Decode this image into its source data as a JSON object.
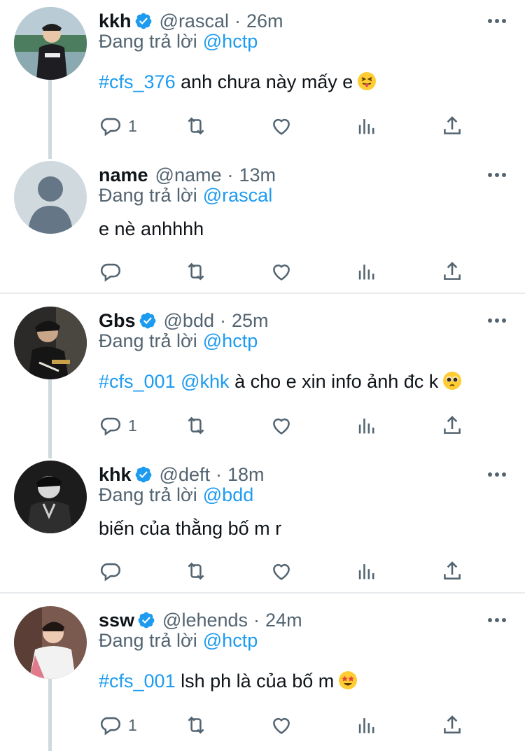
{
  "reply_prefix": "Đang trả lời",
  "tweets": [
    {
      "name": "kkh",
      "verified": true,
      "handle": "@rascal",
      "time": "26m",
      "reply_to": "@hctp",
      "tags": [
        "#cfs_376"
      ],
      "text": "anh chưa này mấy e",
      "emoji": "squinting-tongue",
      "reply_count": "1",
      "avatar": "photo"
    },
    {
      "name": "name",
      "verified": false,
      "handle": "@name",
      "time": "13m",
      "reply_to": "@rascal",
      "tags": [],
      "text": "e nè anhhhh",
      "emoji": "",
      "reply_count": "",
      "avatar": "default"
    },
    {
      "name": "Gbs",
      "verified": true,
      "handle": "@bdd",
      "time": "25m",
      "reply_to": "@hctp",
      "tags": [
        "#cfs_001",
        "@khk"
      ],
      "text": "à cho e xin info ảnh đc k",
      "emoji": "pleading",
      "reply_count": "1",
      "avatar": "photo"
    },
    {
      "name": "khk",
      "verified": true,
      "handle": "@deft",
      "time": "18m",
      "reply_to": "@bdd",
      "tags": [],
      "text": "biến của thằng bố m r",
      "emoji": "",
      "reply_count": "",
      "avatar": "photo"
    },
    {
      "name": "ssw",
      "verified": true,
      "handle": "@lehends",
      "time": "24m",
      "reply_to": "@hctp",
      "tags": [
        "#cfs_001"
      ],
      "text": "lsh ph là của bố m",
      "emoji": "star-struck",
      "reply_count": "1",
      "avatar": "photo"
    }
  ],
  "icons": {
    "reply": "reply-icon",
    "retweet": "retweet-icon",
    "like": "heart-icon",
    "views": "analytics-icon",
    "share": "share-icon",
    "more": "more-icon",
    "verified": "verified-badge-icon"
  },
  "colors": {
    "link": "#1d9bf0",
    "secondary": "#536471",
    "text": "#0f1419",
    "thread_line": "#cfd9de"
  }
}
